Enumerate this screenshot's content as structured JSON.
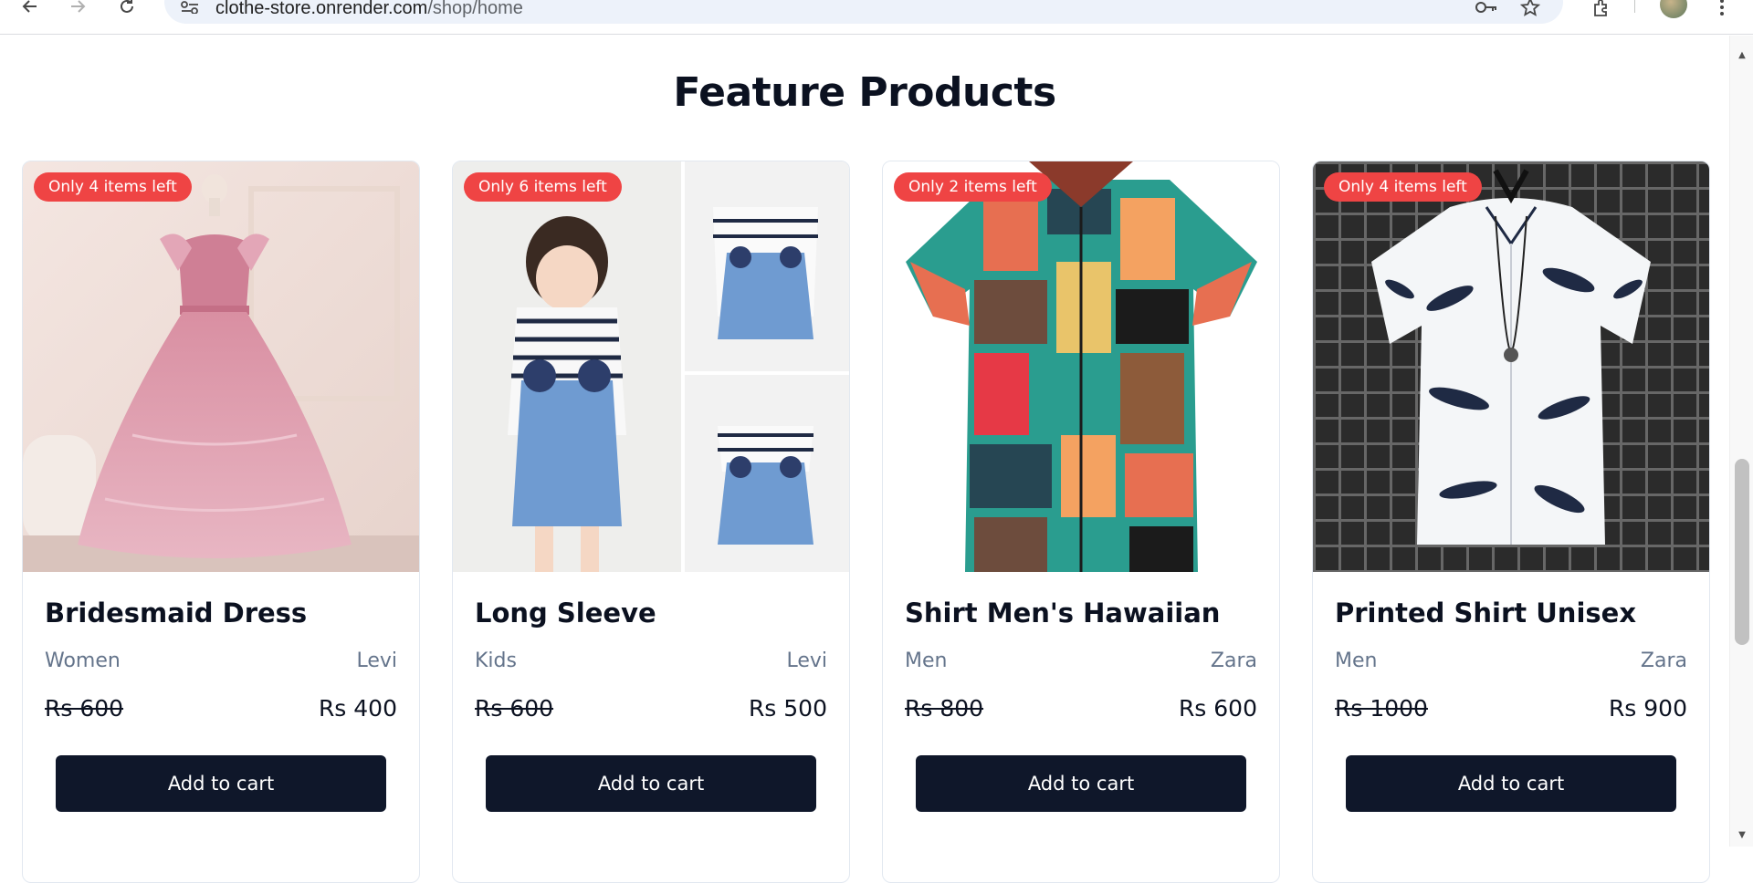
{
  "browser": {
    "url_host": "clothe-store.onrender.com",
    "url_path": "/shop/home"
  },
  "section": {
    "title": "Feature Products"
  },
  "products": [
    {
      "badge": "Only 4 items left",
      "name": "Bridesmaid Dress",
      "category": "Women",
      "brand": "Levi",
      "old_price": "Rs 600",
      "new_price": "Rs 400",
      "button": "Add to cart"
    },
    {
      "badge": "Only 6 items left",
      "name": "Long Sleeve",
      "category": "Kids",
      "brand": "Levi",
      "old_price": "Rs 600",
      "new_price": "Rs 500",
      "button": "Add to cart"
    },
    {
      "badge": "Only 2 items left",
      "name": "Shirt Men's Hawaiian",
      "category": "Men",
      "brand": "Zara",
      "old_price": "Rs 800",
      "new_price": "Rs 600",
      "button": "Add to cart"
    },
    {
      "badge": "Only 4 items left",
      "name": "Printed Shirt Unisex",
      "category": "Men",
      "brand": "Zara",
      "old_price": "Rs 1000",
      "new_price": "Rs 900",
      "button": "Add to cart"
    }
  ],
  "colors": {
    "badge": "#ef4444",
    "button": "#0f172a",
    "muted_text": "#64748b"
  }
}
